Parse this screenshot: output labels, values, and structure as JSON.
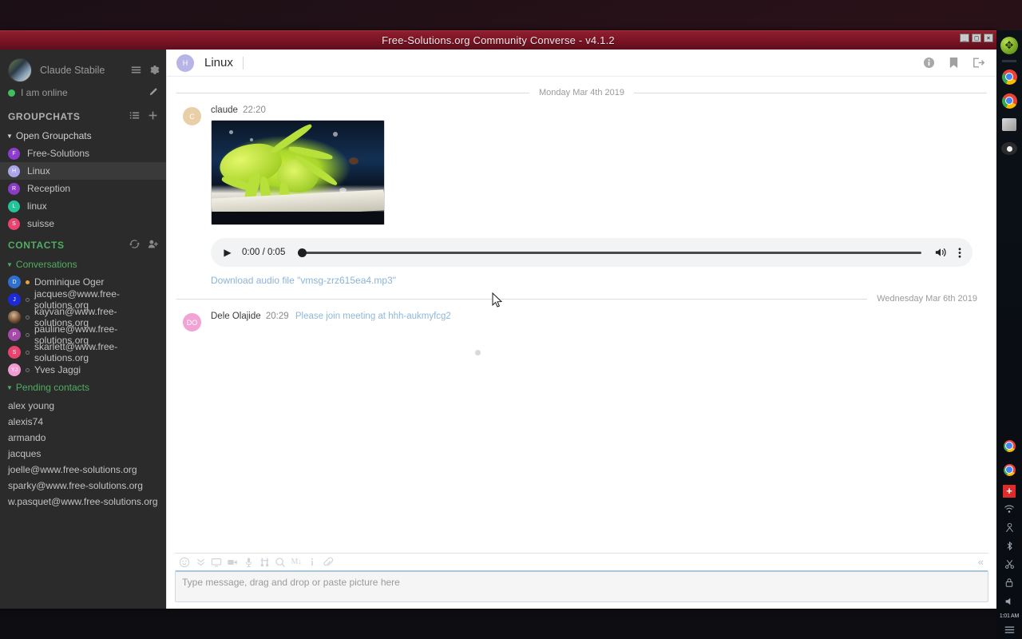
{
  "window": {
    "title": "Free-Solutions.org Community Converse - v4.1.2",
    "minimize_label": "_",
    "maximize_label": "□",
    "close_label": "×"
  },
  "sidebar": {
    "profile": {
      "name": "Claude Stabile",
      "status_text": "I am online",
      "status_color": "#3fbf5f",
      "menu_icon": "hamburger-menu-icon",
      "settings_icon": "gear-icon",
      "edit_icon": "pencil-icon"
    },
    "groupchats": {
      "heading": "GROUPCHATS",
      "list_icon": "list-icon",
      "add_icon": "plus-icon",
      "toggle_label": "Open Groupchats",
      "rooms": [
        {
          "initial": "F",
          "label": "Free-Solutions",
          "color": "#8c3ccf",
          "active": false
        },
        {
          "initial": "H",
          "label": "Linux",
          "color": "#aaa6ea",
          "active": true
        },
        {
          "initial": "R",
          "label": "Reception",
          "color": "#8a3cc4",
          "active": false
        },
        {
          "initial": "L",
          "label": "linux",
          "color": "#24c39a",
          "active": false
        },
        {
          "initial": "S",
          "label": "suisse",
          "color": "#e8446e",
          "active": false
        }
      ]
    },
    "contacts": {
      "heading": "CONTACTS",
      "sync_icon": "refresh-icon",
      "add_contact_icon": "add-person-icon",
      "conversations_label": "Conversations",
      "conversations": [
        {
          "initial": "D",
          "label": "Dominique Oger",
          "color": "#2f6fd0",
          "presence": "online"
        },
        {
          "initial": "J",
          "label": "jacques@www.free-solutions.org",
          "color": "#1c2bd6",
          "presence": "offline"
        },
        {
          "initial": "",
          "label": "kayvan@www.free-solutions.org",
          "color": "#6b4a32",
          "presence": "offline",
          "photo": true
        },
        {
          "initial": "P",
          "label": "pauline@www.free-solutions.org",
          "color": "#a44aa8",
          "presence": "offline"
        },
        {
          "initial": "S",
          "label": "skarlett@www.free-solutions.org",
          "color": "#e8446e",
          "presence": "offline"
        },
        {
          "initial": "YJ",
          "label": "Yves Jaggi",
          "color": "#f39ad0",
          "presence": "offline"
        }
      ],
      "pending_label": "Pending contacts",
      "pending": [
        "alex young",
        "alexis74",
        "armando",
        "jacques",
        "joelle@www.free-solutions.org",
        "sparky@www.free-solutions.org",
        "w.pasquet@www.free-solutions.org"
      ]
    }
  },
  "chat": {
    "header": {
      "avatar_initial": "H",
      "title": "Linux",
      "info_icon": "info-icon",
      "bookmark_icon": "bookmark-icon",
      "leave_icon": "leave-room-icon"
    },
    "separators": {
      "first": "Monday Mar 4th 2019",
      "second": "Wednesday Mar 6th 2019"
    },
    "messages": [
      {
        "avatar_initial": "C",
        "avatar_color": "#e8cfa8",
        "author": "claude",
        "time": "22:20",
        "has_image": true,
        "image_alt": "green spider on plank photo",
        "audio": {
          "play_label": "play-button",
          "time_display": "0:00 / 0:05",
          "volume_icon": "volume-icon",
          "menu_icon": "kebab-menu-icon"
        },
        "download_link": "Download audio file \"vmsg-zrz615ea4.mp3\""
      },
      {
        "avatar_initial": "DO",
        "avatar_color": "#f0a3d4",
        "author": "Dele Olajide",
        "time": "20:29",
        "body": "Please join meeting at hhh-aukmyfcg2"
      }
    ],
    "toolbar": [
      {
        "icon": "emoji-icon",
        "glyph": "☺"
      },
      {
        "icon": "chevron-down-icon",
        "glyph": "⌄"
      },
      {
        "icon": "screen-share-icon",
        "glyph": "▭"
      },
      {
        "icon": "video-camera-icon",
        "glyph": "▮"
      },
      {
        "icon": "microphone-icon",
        "glyph": "🎤"
      },
      {
        "icon": "tuning-fork-icon",
        "glyph": "⑁"
      },
      {
        "icon": "search-icon",
        "glyph": "🔍"
      },
      {
        "icon": "markdown-icon",
        "glyph": "M↓"
      },
      {
        "icon": "info-icon",
        "glyph": "i"
      },
      {
        "icon": "attachment-icon",
        "glyph": "📎"
      }
    ],
    "collapse_icon": "collapse-toolbar-icon",
    "composer_placeholder": "Type message, drag and drop or paste picture here"
  },
  "dock": {
    "clock": "1:01 AM",
    "items": [
      {
        "name": "ubuntu-launcher-icon",
        "glyph": "✥"
      },
      {
        "name": "chrome-icon-1",
        "glyph": ""
      },
      {
        "name": "chrome-icon-2",
        "glyph": ""
      },
      {
        "name": "files-icon",
        "glyph": ""
      },
      {
        "name": "media-player-icon",
        "glyph": ""
      },
      {
        "name": "chrome-tray-icon-1",
        "glyph": ""
      },
      {
        "name": "chrome-tray-icon-2",
        "glyph": ""
      },
      {
        "name": "swiss-flag-icon",
        "glyph": "+"
      },
      {
        "name": "wifi-icon",
        "glyph": "▾"
      },
      {
        "name": "user-account-icon",
        "glyph": "⚲"
      },
      {
        "name": "bluetooth-icon",
        "glyph": "✲"
      },
      {
        "name": "scissors-icon",
        "glyph": "✂"
      },
      {
        "name": "lock-icon",
        "glyph": "🔒"
      },
      {
        "name": "volume-icon",
        "glyph": "◀"
      },
      {
        "name": "system-menu-icon",
        "glyph": "≡"
      }
    ]
  }
}
